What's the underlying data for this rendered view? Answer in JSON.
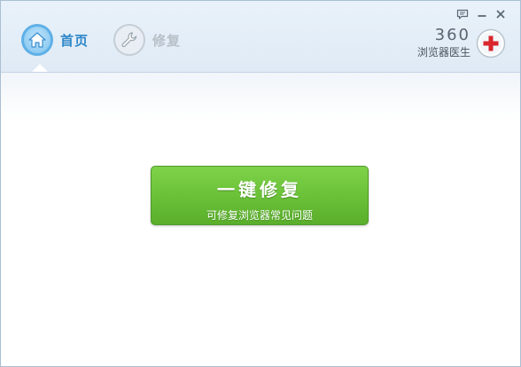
{
  "nav": {
    "items": [
      {
        "label": "首页",
        "icon": "home-icon",
        "active": true
      },
      {
        "label": "修复",
        "icon": "wrench-icon",
        "active": false
      }
    ]
  },
  "window_controls": [
    "feedback-icon",
    "minimize-icon",
    "close-icon"
  ],
  "brand": {
    "number": "360",
    "name": "浏览器医生",
    "logo_icon": "red-cross-icon"
  },
  "main_button": {
    "title": "一键修复",
    "subtitle": "可修复浏览器常见问题"
  },
  "colors": {
    "accent_blue": "#2e87c9",
    "button_green": "#6bc238",
    "cross_red": "#d9262b"
  }
}
